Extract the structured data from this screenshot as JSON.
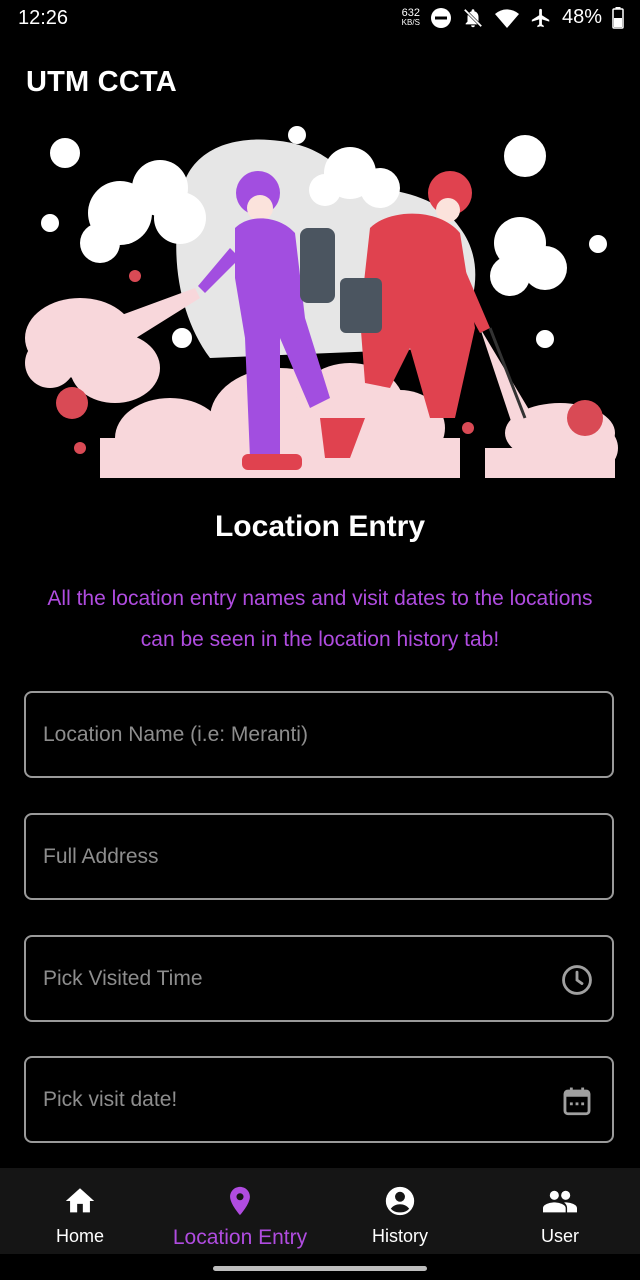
{
  "status_bar": {
    "time": "12:26",
    "net_speed_value": "632",
    "net_speed_unit": "KB/S",
    "battery": "48%"
  },
  "app": {
    "title": "UTM CCTA"
  },
  "page": {
    "title": "Location Entry",
    "description": "All the location entry names and visit dates to the locations can be seen in the location history tab!"
  },
  "form": {
    "location_name": {
      "placeholder": "Location Name (i.e: Meranti)",
      "value": ""
    },
    "full_address": {
      "placeholder": "Full Address",
      "value": ""
    },
    "visited_time": {
      "placeholder": "Pick Visited Time",
      "value": "",
      "icon": "clock-icon"
    },
    "visit_date": {
      "placeholder": "Pick visit date!",
      "value": "",
      "icon": "calendar-icon"
    }
  },
  "bottom_nav": {
    "items": [
      {
        "label": "Home",
        "icon": "home-icon"
      },
      {
        "label": "Location Entry",
        "icon": "location-pin-icon",
        "active": true
      },
      {
        "label": "History",
        "icon": "account-circle-icon"
      },
      {
        "label": "User",
        "icon": "group-icon"
      }
    ]
  },
  "colors": {
    "accent": "#b04ce0",
    "background": "#000000",
    "nav_background": "#151515",
    "field_border": "#9a9a9a"
  }
}
